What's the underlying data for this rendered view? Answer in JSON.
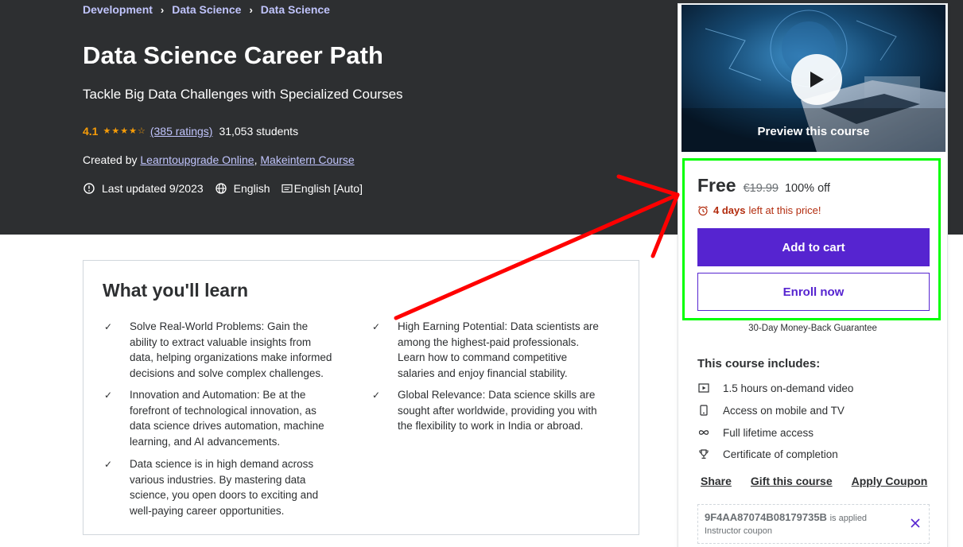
{
  "breadcrumb": [
    "Development",
    "Data Science",
    "Data Science"
  ],
  "course": {
    "title": "Data Science Career Path",
    "subtitle": "Tackle Big Data Challenges with Specialized Courses",
    "rating": "4.1",
    "stars": 4.1,
    "ratings_count": "(385 ratings)",
    "students": "31,053 students",
    "created_by_label": "Created by",
    "instructor_1": "Learntoupgrade Online",
    "separator": ",",
    "instructor_2": "Makeintern Course",
    "last_updated": "Last updated 9/2023",
    "language": "English",
    "captions": "English [Auto]"
  },
  "learn": {
    "title": "What you'll learn",
    "items": [
      "Solve Real-World Problems: Gain the ability to extract valuable insights from data, helping organizations make informed decisions and solve complex challenges.",
      "High Earning Potential: Data scientists are among the highest-paid professionals. Learn how to command competitive salaries and enjoy financial stability.",
      "Innovation and Automation: Be at the forefront of technological innovation, as data science drives automation, machine learning, and AI advancements.",
      "Global Relevance: Data science skills are sought after worldwide, providing you with the flexibility to work in India or abroad.",
      "Data science is in high demand across various industries. By mastering data science, you open doors to exciting and well-paying career opportunities."
    ]
  },
  "sidebar": {
    "preview_label": "Preview this course",
    "price": "Free",
    "original_price": "€19.99",
    "discount": "100% off",
    "urgency_bold": "4 days",
    "urgency_text": "left at this price!",
    "add_to_cart": "Add to cart",
    "enroll_now": "Enroll now",
    "guarantee": "30-Day Money-Back Guarantee",
    "includes_title": "This course includes:",
    "includes": [
      {
        "icon": "video-icon",
        "label": "1.5 hours on-demand video"
      },
      {
        "icon": "mobile-icon",
        "label": "Access on mobile and TV"
      },
      {
        "icon": "infinity-icon",
        "label": "Full lifetime access"
      },
      {
        "icon": "trophy-icon",
        "label": "Certificate of completion"
      }
    ],
    "actions": {
      "share": "Share",
      "gift": "Gift this course",
      "coupon": "Apply Coupon"
    },
    "coupon_code": "9F4AA87074B08179735B",
    "coupon_applied": "is applied",
    "coupon_type": "Instructor coupon"
  },
  "colors": {
    "hero_bg": "#2d2f31",
    "accent": "#5624d0",
    "link": "#c0c4fc",
    "star": "#f69c08",
    "urgency": "#b32d0f",
    "highlight_frame": "#00ff00",
    "annotation_arrow": "#ff0000"
  }
}
